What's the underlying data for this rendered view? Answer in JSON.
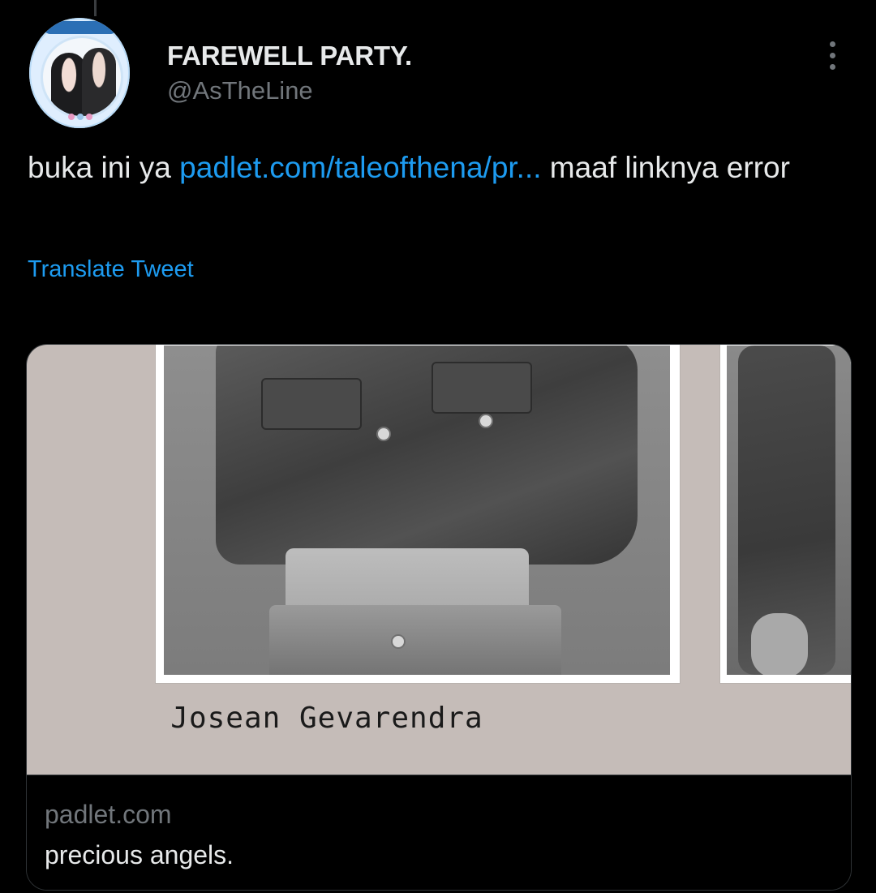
{
  "tweet": {
    "author": {
      "display_name": "FAREWELL PARTY.",
      "handle": "@AsTheLine"
    },
    "text_before_link": "buka ini ya ",
    "link_text": "padlet.com/taleofthena/pr...",
    "text_after_link": " maaf linknya error",
    "translate_label": "Translate Tweet"
  },
  "card": {
    "media_caption": "Josean Gevarendra",
    "domain": "padlet.com",
    "title": "precious angels."
  },
  "icons": {
    "more": "more-vertical-icon"
  },
  "colors": {
    "background": "#000000",
    "text_primary": "#e7e9ea",
    "text_secondary": "#71767b",
    "link": "#1d9bf0",
    "card_border": "#2f3336",
    "media_background": "#c5bcb8"
  }
}
